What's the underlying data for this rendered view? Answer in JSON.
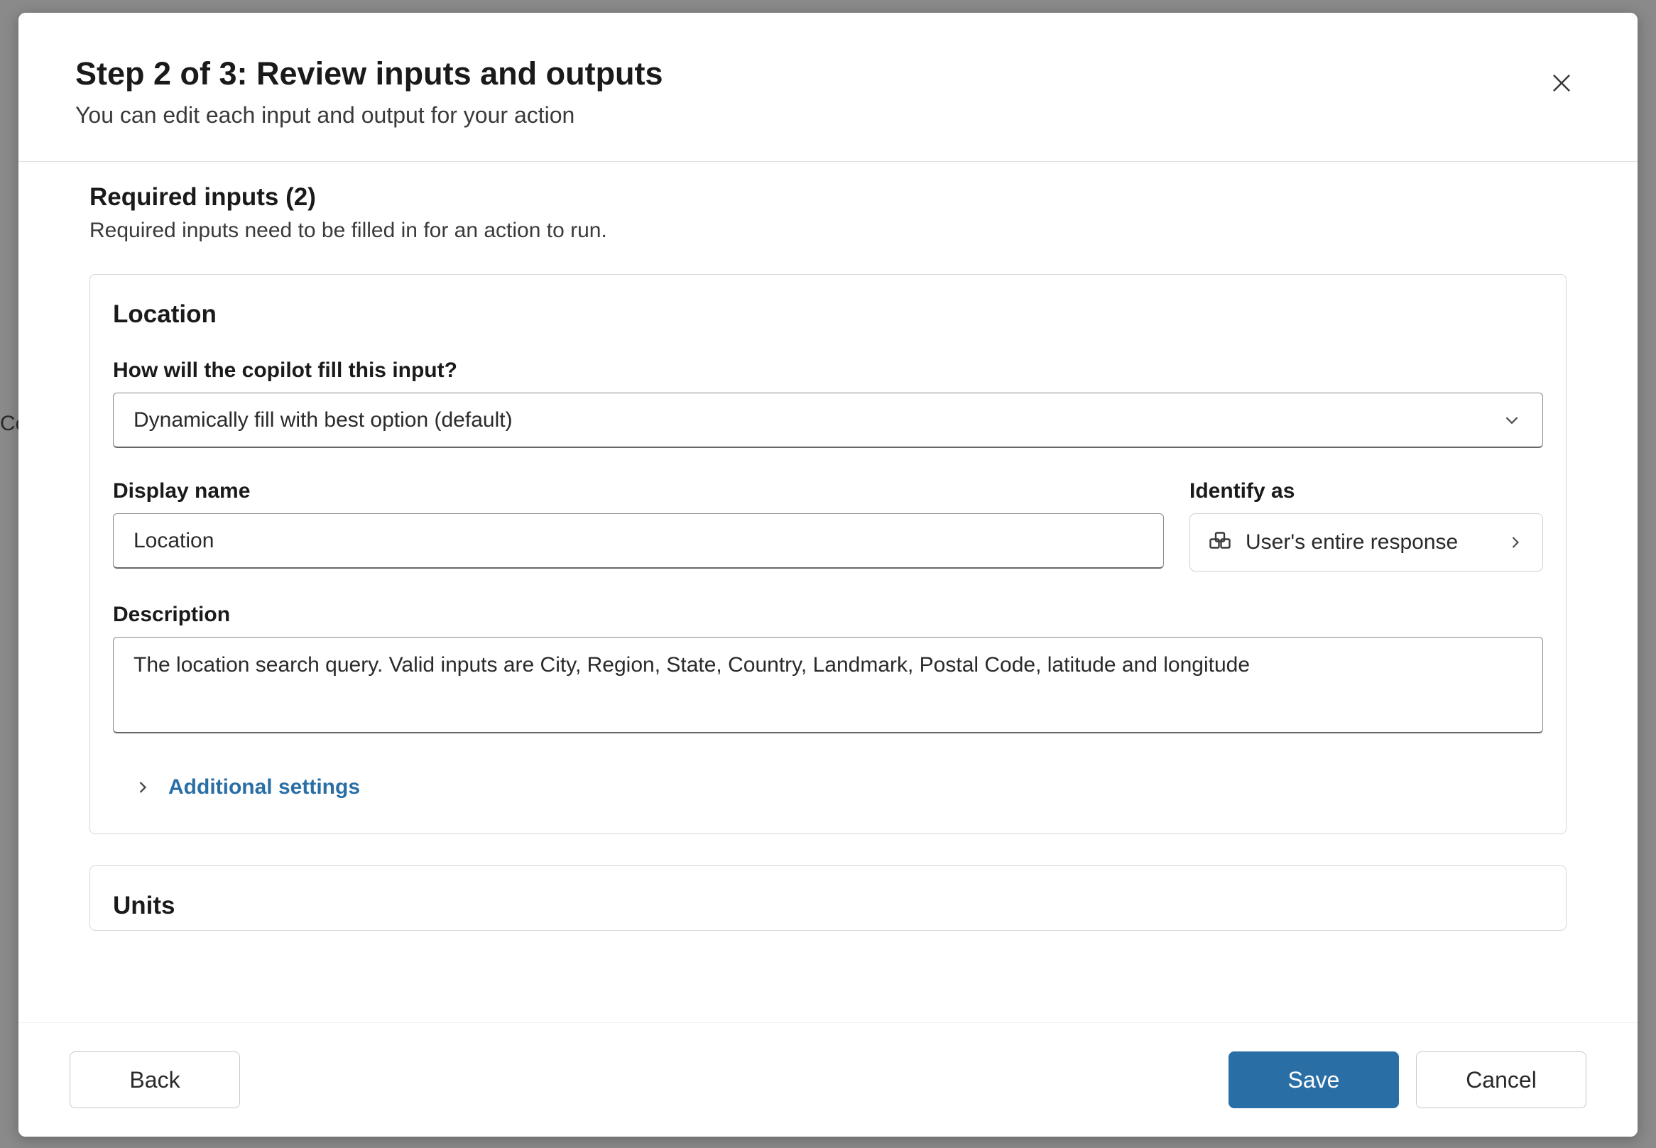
{
  "header": {
    "title": "Step 2 of 3: Review inputs and outputs",
    "subtitle": "You can edit each input and output for your action"
  },
  "section": {
    "title": "Required inputs (2)",
    "subtitle": "Required inputs need to be filled in for an action to run."
  },
  "inputs": [
    {
      "name": "Location",
      "fill_question": "How will the copilot fill this input?",
      "fill_option": "Dynamically fill with best option (default)",
      "display_name_label": "Display name",
      "display_name_value": "Location",
      "identify_label": "Identify as",
      "identify_value": "User's entire response",
      "description_label": "Description",
      "description_value": "The location search query. Valid inputs are City, Region, State, Country, Landmark, Postal Code, latitude and longitude",
      "additional_label": "Additional settings"
    },
    {
      "name": "Units"
    }
  ],
  "footer": {
    "back": "Back",
    "save": "Save",
    "cancel": "Cancel"
  },
  "bg_hint": "Co"
}
